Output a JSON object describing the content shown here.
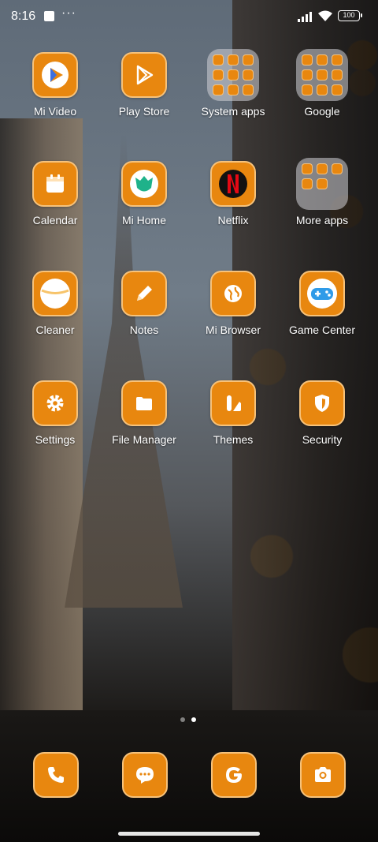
{
  "status_bar": {
    "time": "8:16",
    "notif_more": "···",
    "battery": "100"
  },
  "apps": {
    "mi_video": "Mi Video",
    "play_store": "Play Store",
    "system_apps": "System apps",
    "google": "Google",
    "calendar": "Calendar",
    "mi_home": "Mi Home",
    "netflix": "Netflix",
    "more_apps": "More apps",
    "cleaner": "Cleaner",
    "notes": "Notes",
    "mi_browser": "Mi Browser",
    "game_center": "Game Center",
    "settings": "Settings",
    "file_manager": "File Manager",
    "themes": "Themes",
    "security": "Security"
  },
  "dock": {
    "icons": [
      "phone-icon",
      "messages-icon",
      "google-icon",
      "camera-icon"
    ]
  },
  "page_indicator": {
    "pages": 2,
    "current": 2
  },
  "colors": {
    "tile": "#e8870f",
    "tile_border": "#f6c27b",
    "text": "#ffffff"
  }
}
